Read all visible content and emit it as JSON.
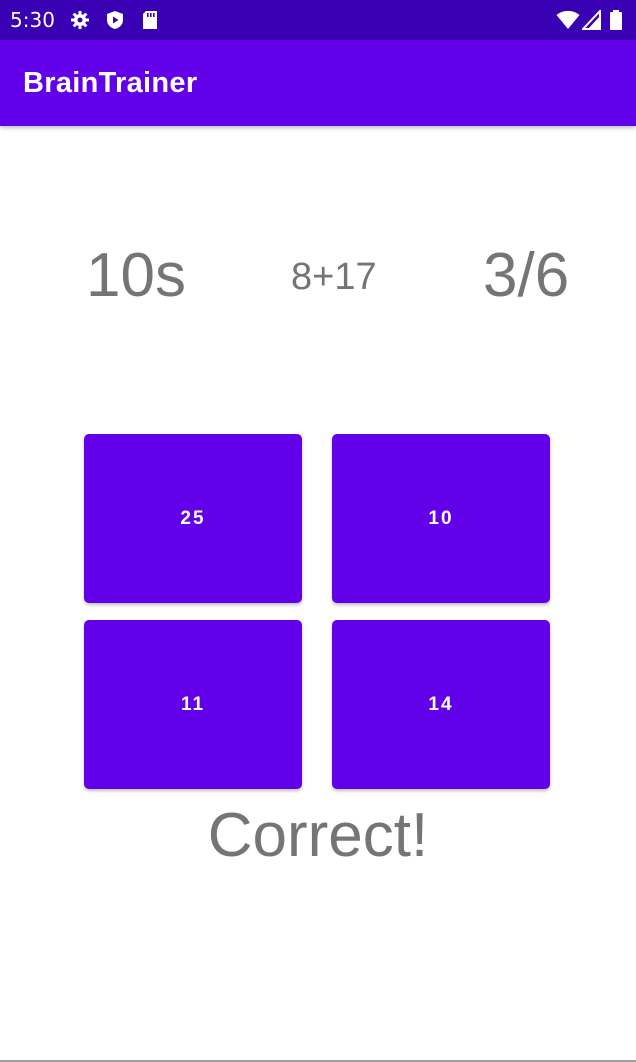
{
  "status_bar": {
    "time": "5:30",
    "left_icons": [
      "gear-icon",
      "play-shield-icon",
      "sd-card-icon"
    ],
    "right_icons": [
      "wifi-icon",
      "cell-signal-icon",
      "battery-icon"
    ],
    "background_color": "#3a00b3"
  },
  "app_bar": {
    "title": "BrainTrainer",
    "background_color": "#6200ea"
  },
  "game": {
    "timer": "10s",
    "question": "8+17",
    "score": "3/6",
    "answers": [
      "25",
      "10",
      "11",
      "14"
    ],
    "result": "Correct!"
  },
  "colors": {
    "accent": "#6200ea",
    "text_gray": "#757575"
  }
}
